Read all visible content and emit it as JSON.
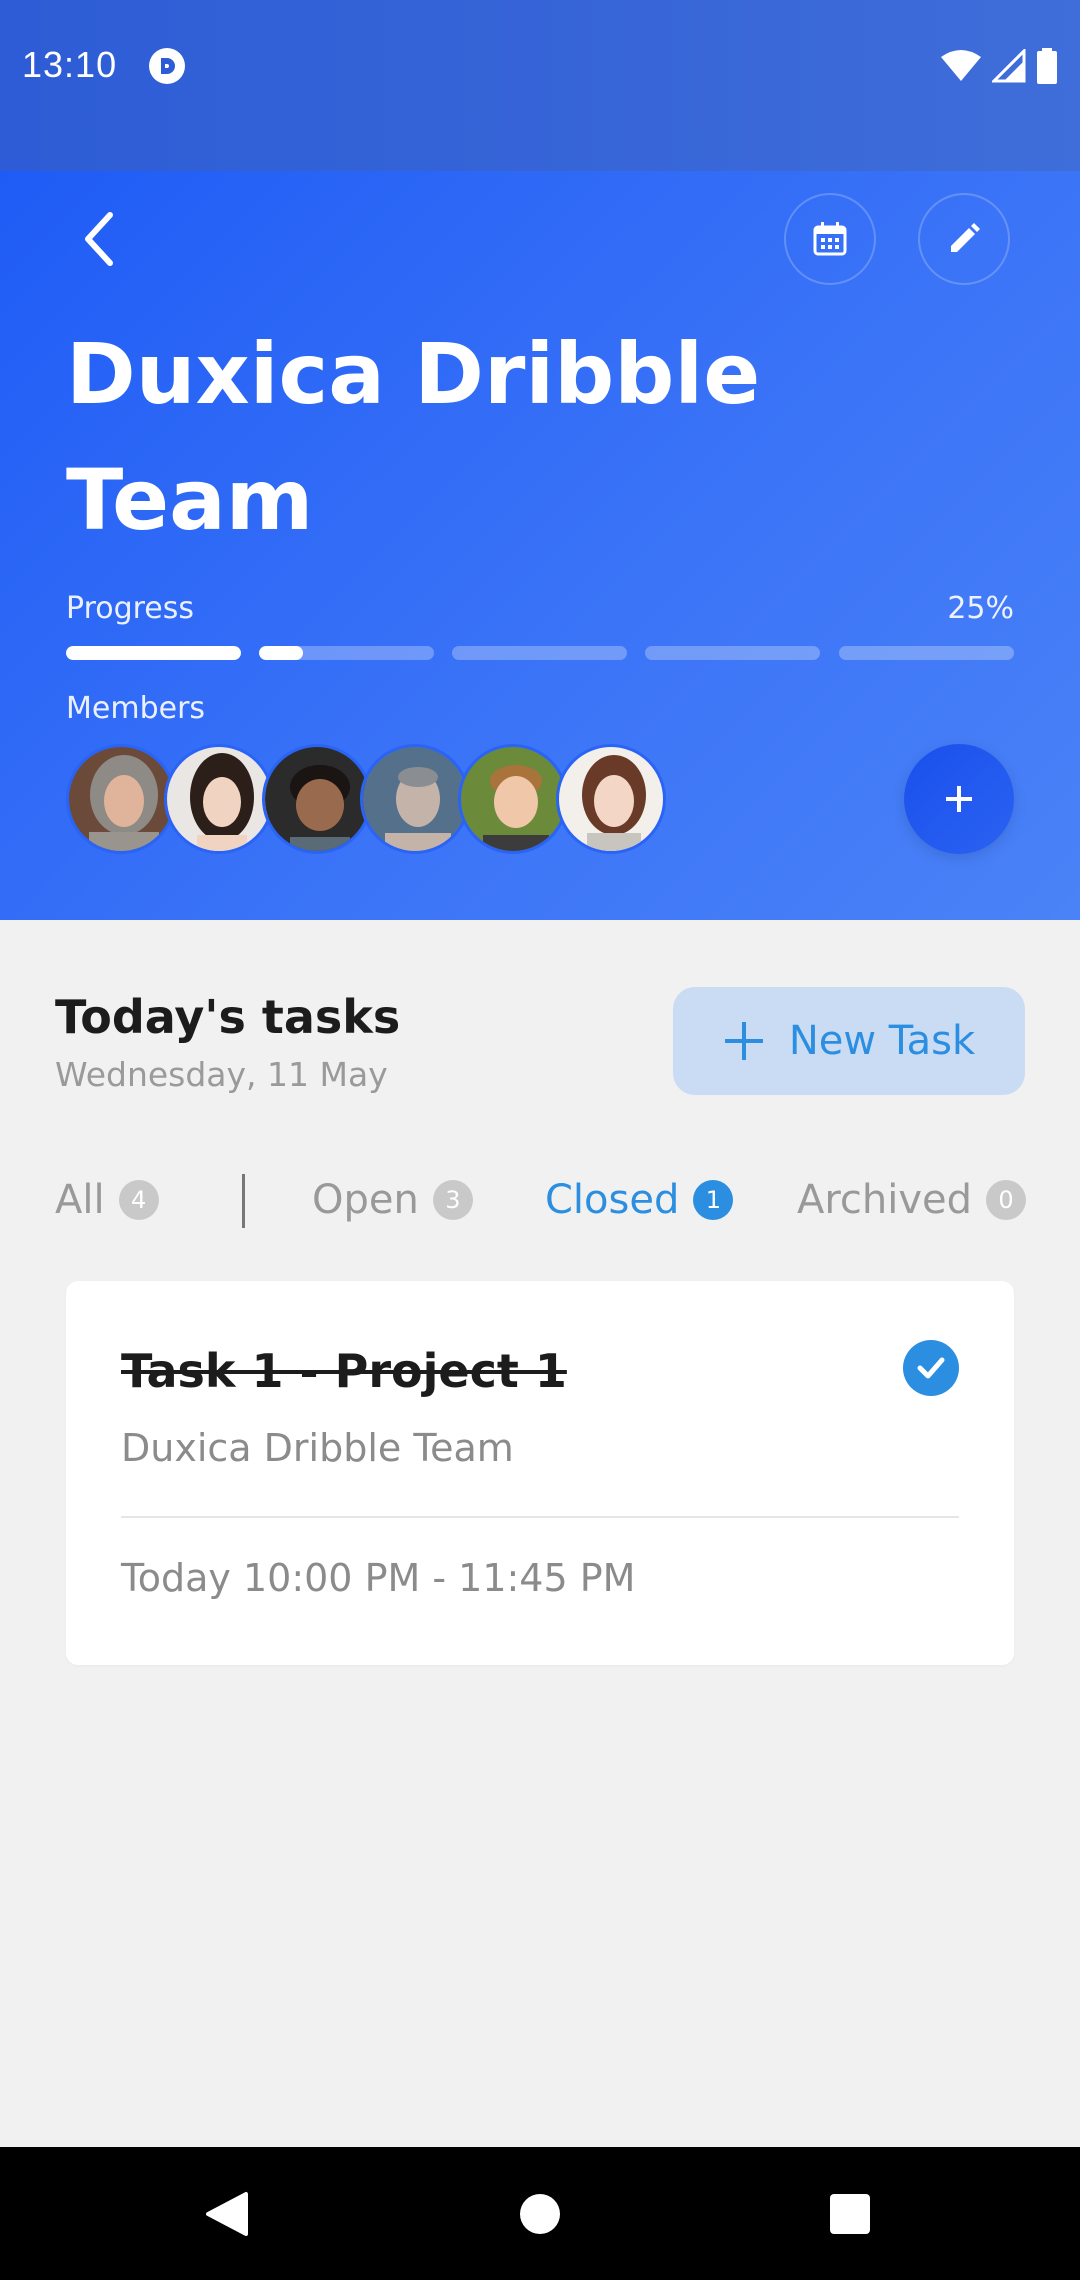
{
  "status_bar": {
    "time": "13:10"
  },
  "header": {
    "title_line1": "Duxica Dribble",
    "title_line2": "Team",
    "progress_label": "Progress",
    "progress_percent_text": "25%",
    "progress_fraction": 0.25,
    "members_label": "Members",
    "member_count": 6
  },
  "tasks": {
    "title": "Today's tasks",
    "date": "Wednesday, 11 May",
    "new_task_label": "New Task",
    "tabs": [
      {
        "label": "All",
        "count": "4"
      },
      {
        "label": "Open",
        "count": "3"
      },
      {
        "label": "Closed",
        "count": "1",
        "active": true
      },
      {
        "label": "Archived",
        "count": "0"
      }
    ],
    "items": [
      {
        "title": "Task 1 - Project 1",
        "team": "Duxica Dribble Team",
        "time": "Today 10:00 PM - 11:45 PM",
        "completed": true
      }
    ]
  },
  "colors": {
    "header_gradient_start": "#1f5cf6",
    "header_gradient_end": "#4a82f7",
    "accent": "#2c8ee0",
    "new_task_bg": "#c9dcf4",
    "badge_inactive": "#c9c9c9"
  },
  "icons": {
    "back": "chevron-left-icon",
    "calendar": "calendar-icon",
    "edit": "pencil-icon",
    "add_member": "plus-icon",
    "new_task": "plus-icon",
    "task_done": "check-circle-icon"
  }
}
